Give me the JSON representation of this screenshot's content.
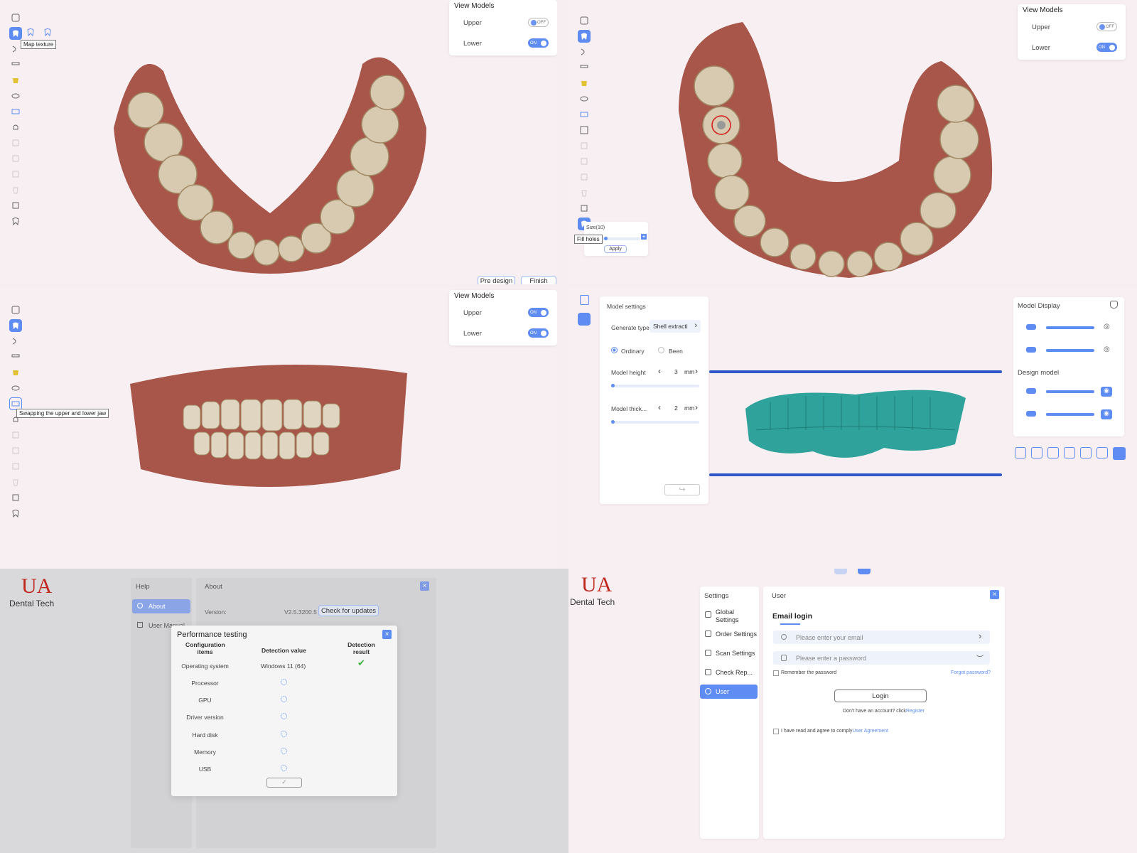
{
  "colors": {
    "accent": "#5e8cf2",
    "background_pink": "#f8eff2",
    "background_gray": "#d9d8da",
    "teal_model": "#2fa39b",
    "logo_red": "#c0281e"
  },
  "panel1": {
    "tooltip": "Map texture",
    "view_models": {
      "title": "View Models",
      "upper": "Upper",
      "lower": "Lower",
      "upper_state": "OFF",
      "lower_state": "ON"
    },
    "pre_design": "Pre design",
    "finish": "Finish"
  },
  "panel2": {
    "view_models": {
      "title": "View Models",
      "upper": "Upper",
      "lower": "Lower",
      "upper_state": "OFF",
      "lower_state": "ON"
    },
    "fill_holes": {
      "size_label": "Size(10)",
      "tooltip": "Fill holes",
      "apply": "Apply"
    }
  },
  "panel3": {
    "tooltip": "Swapping the upper and lower jaw",
    "view_models": {
      "title": "View Models",
      "upper": "Upper",
      "lower": "Lower",
      "upper_state": "ON",
      "lower_state": "ON"
    }
  },
  "panel4": {
    "model_settings": {
      "title": "Model settings",
      "generate_type_label": "Generate type",
      "generate_type_value": "Shell extracti",
      "radio_ordinary": "Ordinary",
      "radio_been": "Been",
      "model_height_label": "Model height",
      "model_height_value": "3",
      "model_height_unit": "mm",
      "model_thickness_label": "Model thick...",
      "model_thickness_value": "2",
      "model_thickness_unit": "mm"
    },
    "model_display": {
      "title": "Model Display",
      "design_model_title": "Design model"
    }
  },
  "panel5": {
    "logo_text": "Dental Tech",
    "help": {
      "title": "Help",
      "items": [
        "About",
        "User Manual"
      ]
    },
    "about": {
      "title": "About",
      "version_label": "Version:",
      "version_value": "V2.5.3200.5",
      "check_updates": "Check for updates"
    },
    "perf": {
      "title": "Performance testing",
      "col_items": "Configuration items",
      "col_value": "Detection value",
      "col_result": "Detection result",
      "rows": [
        {
          "item": "Operating system",
          "value": "Windows 11 (64)"
        },
        {
          "item": "Processor",
          "value": ""
        },
        {
          "item": "GPU",
          "value": ""
        },
        {
          "item": "Driver version",
          "value": ""
        },
        {
          "item": "Hard disk",
          "value": ""
        },
        {
          "item": "Memory",
          "value": ""
        },
        {
          "item": "USB",
          "value": ""
        }
      ]
    }
  },
  "panel6": {
    "logo_text": "Dental Tech",
    "settings_title": "Settings",
    "menu": [
      "Global Settings",
      "Order Settings",
      "Scan Settings",
      "Check Rep...",
      "User"
    ],
    "user_title": "User",
    "email_login": "Email login",
    "email_placeholder": "Please enter your email",
    "password_placeholder": "Please enter a password",
    "remember": "Remember the password",
    "forgot": "Forgot password?",
    "login": "Login",
    "no_account": "Don't have an account? click",
    "register": "Register",
    "agree": "I have read and agree to comply",
    "agreement": "User Agreement"
  }
}
